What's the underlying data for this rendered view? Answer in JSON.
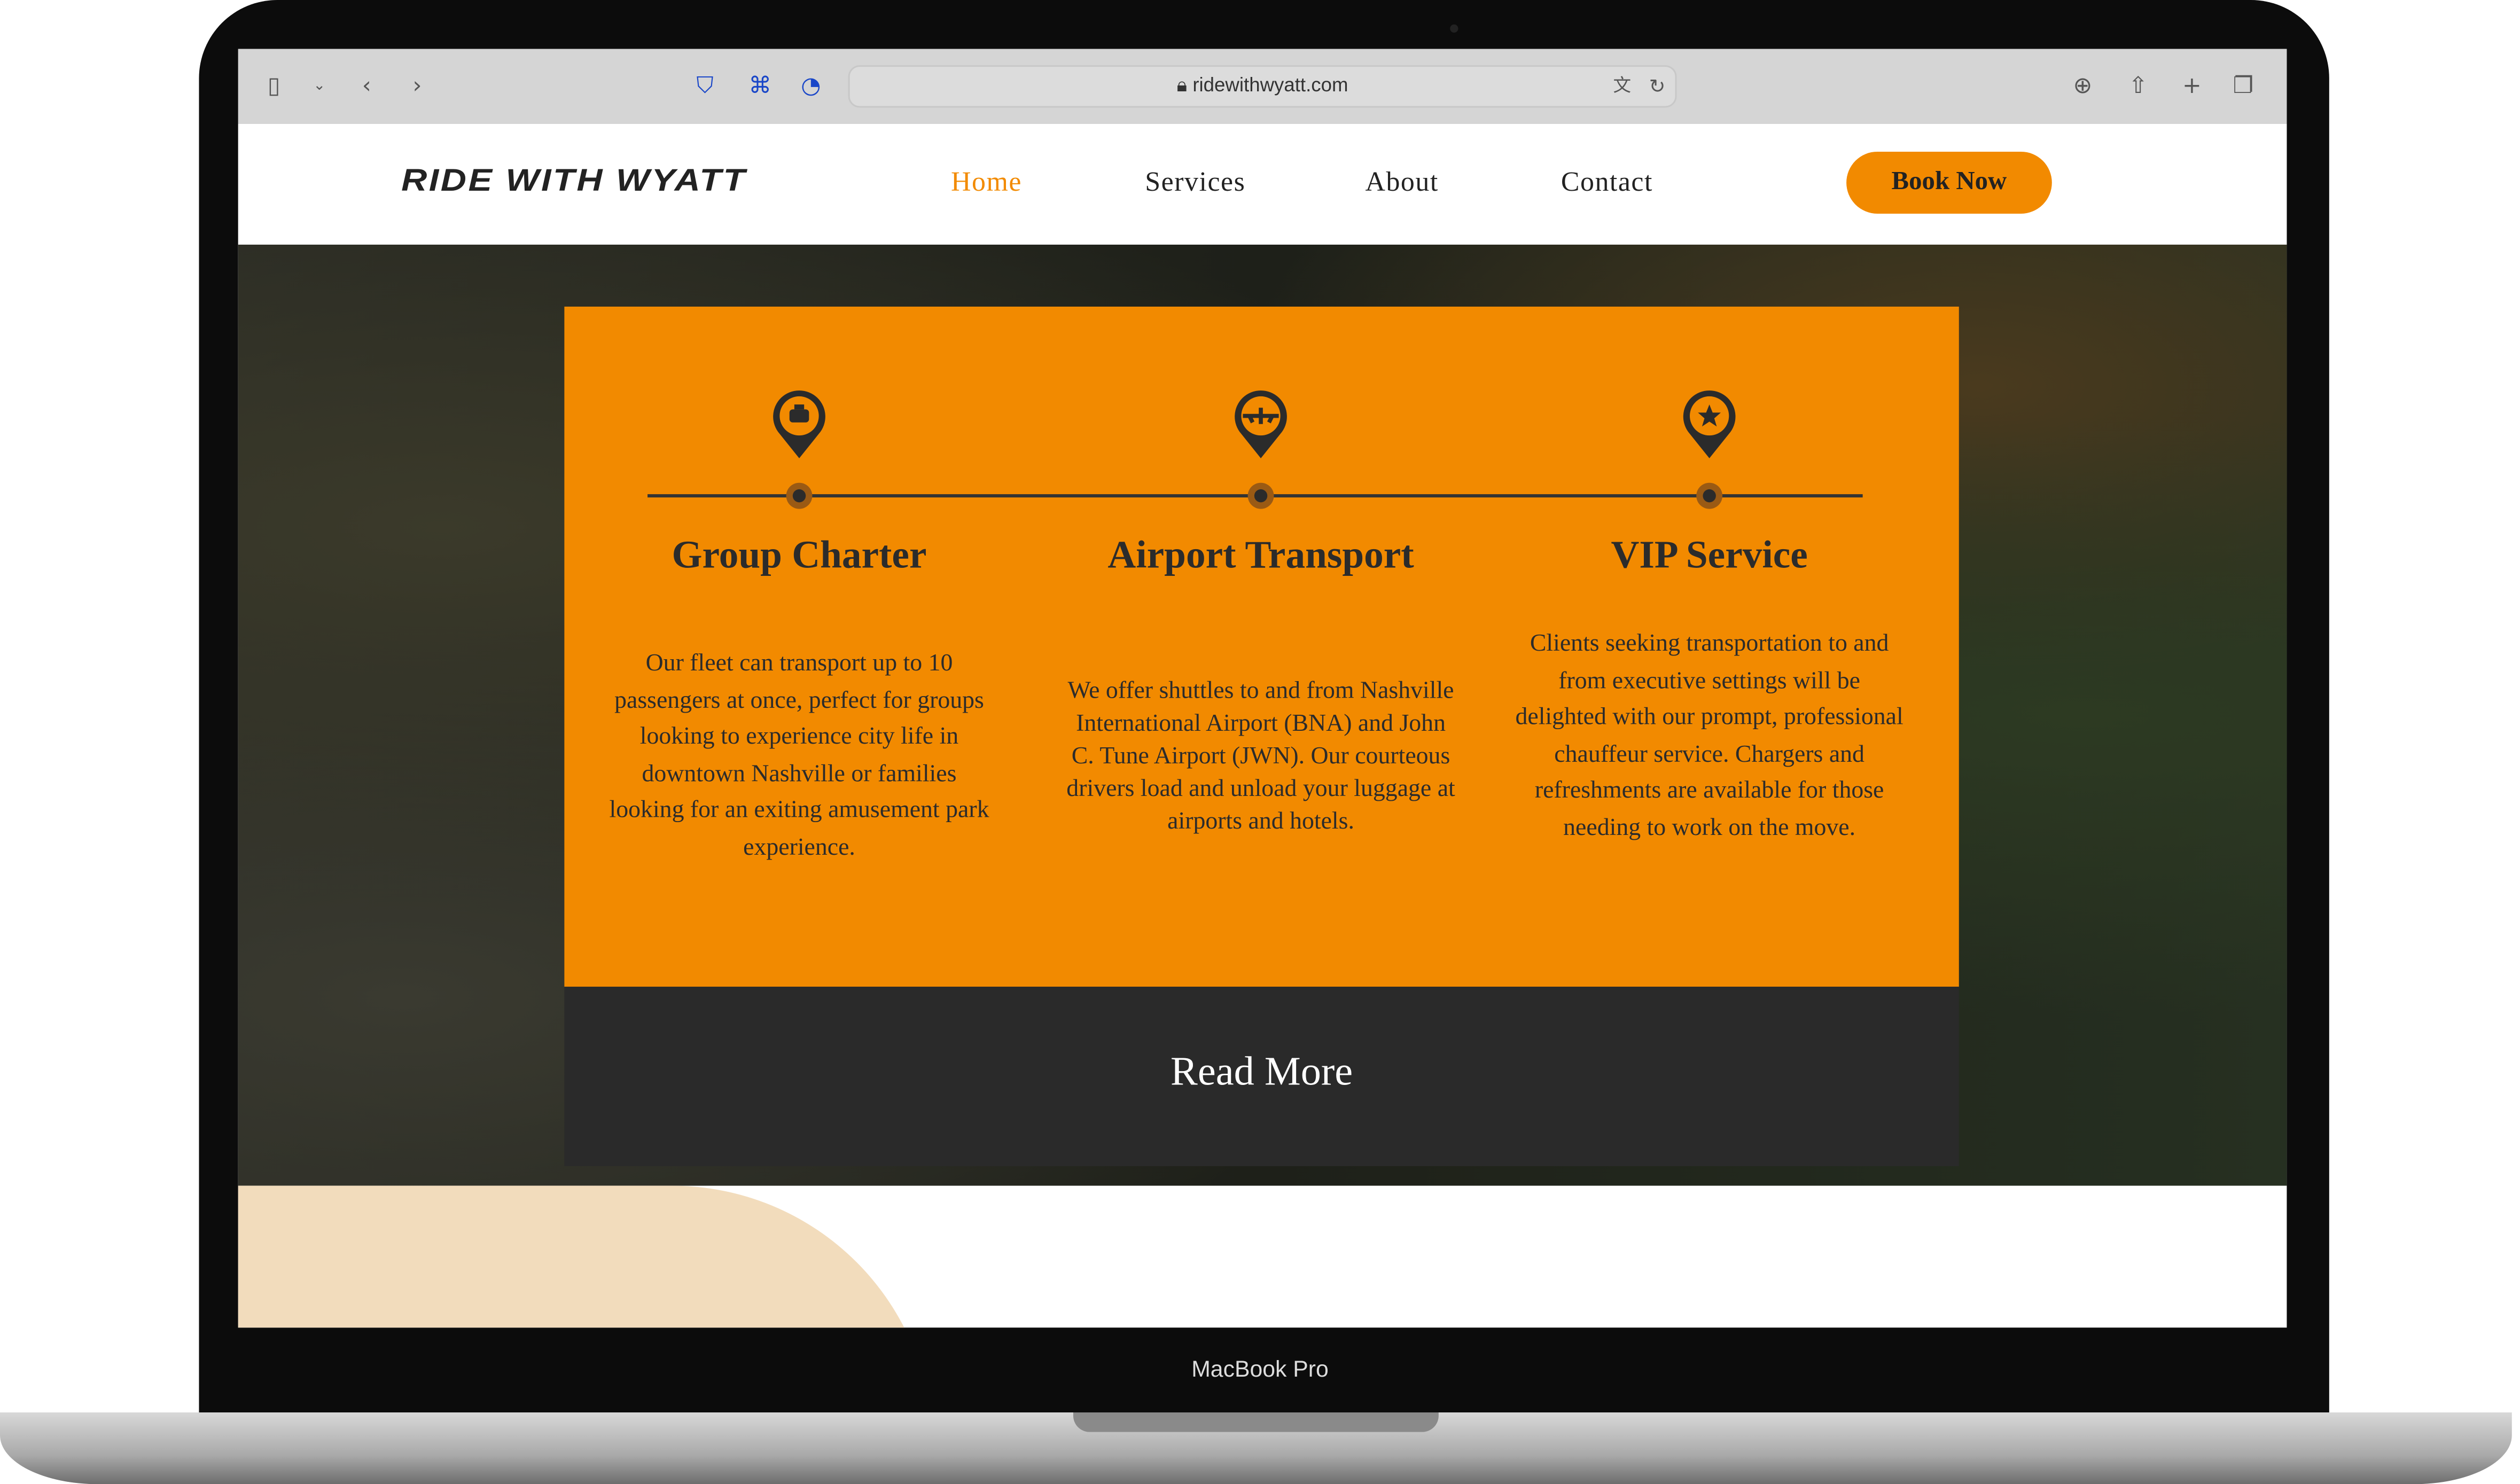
{
  "browser": {
    "url": "ridewithwyatt.com",
    "icons": [
      "sidebar-icon",
      "chevron-down-icon",
      "back-icon",
      "forward-icon",
      "shield-icon",
      "command-icon",
      "clock-icon",
      "lock-icon",
      "translate-icon",
      "reload-icon",
      "download-icon",
      "share-icon",
      "plus-icon",
      "tabs-icon"
    ]
  },
  "nav": {
    "logo": "RIDE WITH WYATT",
    "links": [
      "Home",
      "Services",
      "About",
      "Contact"
    ],
    "active": "Home",
    "book_label": "Book Now"
  },
  "services": [
    {
      "title": "Group Charter",
      "icon": "taxi-pin-icon",
      "text": "Our fleet can transport up to 10 passengers at once, perfect for groups looking to experience city life in downtown Nashville or families looking for an exiting amusement park experience."
    },
    {
      "title": "Airport Transport",
      "icon": "airplane-pin-icon",
      "text": "We offer shuttles to and from Nashville International Airport (BNA) and John C. Tune Airport (JWN). Our courteous drivers load and unload your luggage at airports and hotels."
    },
    {
      "title": "VIP Service",
      "icon": "star-pin-icon",
      "text": "Clients seeking transportation to and from executive settings will be delighted with our prompt, professional chauffeur service. Chargers and refreshments are available for those needing to work on the move."
    }
  ],
  "read_more": "Read More",
  "device_label": "MacBook Pro",
  "colors": {
    "accent": "#f28a00",
    "dark": "#2a2a2a"
  }
}
